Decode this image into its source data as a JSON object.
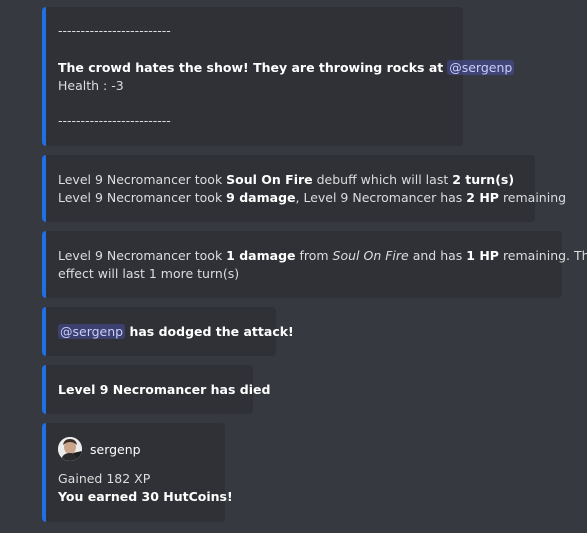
{
  "embeds": {
    "crowd": {
      "dashes_top": "-------------------------",
      "text_bold": "The crowd hates the show! They are throwing rocks at",
      "mention": "@sergenp",
      "health": "Health : -3",
      "dashes_bottom": "-------------------------"
    },
    "debuff": {
      "l1_a": "Level 9 Necromancer took ",
      "l1_b": "Soul On Fire",
      "l1_c": " debuff which will last ",
      "l1_d": "2 turn(s)",
      "l2_a": "Level 9 Necromancer took ",
      "l2_b": "9 damage",
      "l2_c": ", Level 9 Necromancer has ",
      "l2_d": "2 HP",
      "l2_e": " remaining"
    },
    "dot": {
      "a": "Level 9 Necromancer took ",
      "b": "1 damage",
      "c": " from ",
      "d": "Soul On Fire",
      "e": " and has ",
      "f": "1 HP",
      "g": " remaining. This",
      "line2": "effect will last 1 more turn(s)"
    },
    "dodge": {
      "mention": "@sergenp",
      "text": " has dodged the attack!"
    },
    "death": {
      "text": "Level 9 Necromancer has died"
    },
    "reward": {
      "author": "sergenp",
      "xp": "Gained 182 XP",
      "coins": "You earned 30 HutCoins!"
    }
  },
  "colors": {
    "background": "#36393f",
    "embed_background": "#2f3136",
    "embed_accent": "#1f6fe5",
    "mention": "#c9cdfb"
  }
}
